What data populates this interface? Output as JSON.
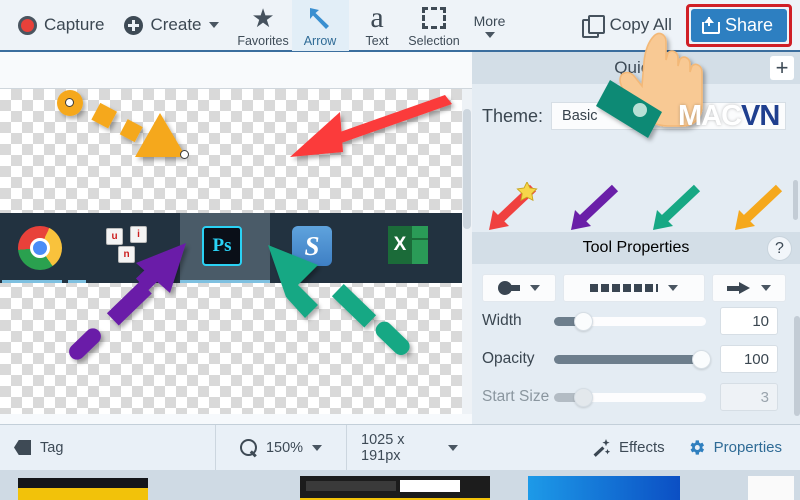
{
  "toolbar": {
    "capture_label": "Capture",
    "create_label": "Create",
    "tools": [
      {
        "label": "Favorites",
        "icon": "star-icon",
        "active": false
      },
      {
        "label": "Arrow",
        "icon": "arrow-icon",
        "active": true
      },
      {
        "label": "Text",
        "icon": "text-a-icon",
        "active": false
      },
      {
        "label": "Selection",
        "icon": "dashed-selection-icon",
        "active": false
      }
    ],
    "more_label": "More",
    "copy_all_label": "Copy All",
    "share_label": "Share",
    "share_highlight_color": "#d01f26",
    "share_button_color": "#2d7fc1"
  },
  "canvas": {
    "dock_apps": [
      "chrome-icon",
      "unikey-icon",
      "photoshop-icon",
      "snagit-icon",
      "excel-icon"
    ],
    "unikey_keys": [
      "u",
      "i",
      "n"
    ],
    "photoshop_label": "Ps",
    "snagit_label": "S",
    "excel_label": "X",
    "annotations": [
      {
        "name": "orange-dashed-arrow",
        "color": "#f5a81c",
        "style": "dashed",
        "direction": "down-right"
      },
      {
        "name": "red-solid-arrow",
        "color": "#fb3b3b",
        "style": "solid",
        "direction": "down-left"
      },
      {
        "name": "purple-dashed-arrow",
        "color": "#6a1fa8",
        "style": "dashed",
        "direction": "up-right"
      },
      {
        "name": "teal-dashed-arrow",
        "color": "#17a884",
        "style": "dashed",
        "direction": "up-left"
      }
    ]
  },
  "statusbar": {
    "tag_label": "Tag",
    "zoom_label": "150%",
    "dimensions_label": "1025 x 191px"
  },
  "quick_panel": {
    "title": "Quick",
    "add_label": "+",
    "theme_label": "Theme:",
    "theme_value": "Basic",
    "theme_arrows": [
      {
        "name": "red-star-arrow",
        "color": "#f0413f"
      },
      {
        "name": "purple-arrow",
        "color": "#6a1fa8"
      },
      {
        "name": "teal-arrow",
        "color": "#17a884"
      },
      {
        "name": "orange-arrow",
        "color": "#f5a81c"
      }
    ]
  },
  "tool_properties": {
    "title": "Tool Properties",
    "help_label": "?",
    "dropdowns": [
      {
        "name": "start-cap-dropdown",
        "icon": "round-cap-icon"
      },
      {
        "name": "dash-style-dropdown",
        "icon": "dashed-line-icon"
      },
      {
        "name": "end-cap-dropdown",
        "icon": "arrow-head-icon"
      }
    ],
    "sliders": [
      {
        "label": "Width",
        "value": "10",
        "percent": 16,
        "disabled": false
      },
      {
        "label": "Opacity",
        "value": "100",
        "percent": 100,
        "disabled": false
      },
      {
        "label": "Start Size",
        "value": "3",
        "percent": 16,
        "disabled": true
      }
    ]
  },
  "bottom_bar": {
    "effects_label": "Effects",
    "properties_label": "Properties"
  },
  "watermark": {
    "part1": "MAC",
    "part2": "VN"
  }
}
